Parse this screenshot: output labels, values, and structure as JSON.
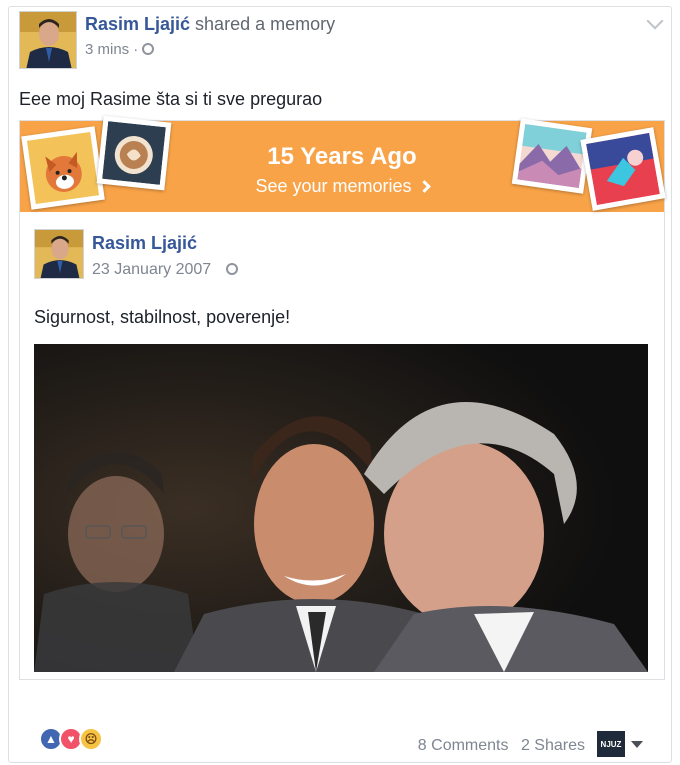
{
  "post": {
    "author": "Rasim Ljajić",
    "action": " shared a memory",
    "time": "3 mins",
    "dot": "·",
    "status": "Eee moj Rasime šta si ti sve pregurao"
  },
  "memory_banner": {
    "title": "15 Years Ago",
    "link": "See your memories",
    "colors": {
      "banner": "#f8a348"
    }
  },
  "original_post": {
    "author": "Rasim Ljajić",
    "date": "23 January 2007",
    "text": "Sigurnost, stabilnost, poverenje!"
  },
  "footer": {
    "reaction_icons": [
      "like-icon",
      "love-icon",
      "sad-icon"
    ],
    "comments": "8 Comments",
    "shares": "2 Shares",
    "share_logo": "NJUZ"
  },
  "colors": {
    "link_blue": "#365899",
    "meta_gray": "#7f8691",
    "like": "#4267b2",
    "love": "#f25268",
    "sad": "#f7c344"
  }
}
